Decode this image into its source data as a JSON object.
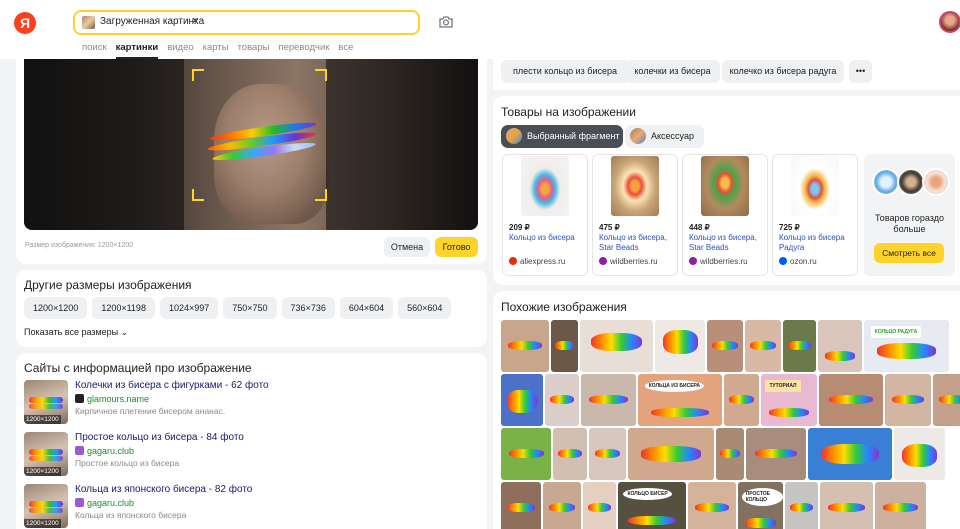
{
  "header": {
    "logo": "Я",
    "search_chip_label": "Загруженная картинка",
    "search_chip_close": "×",
    "tabs": [
      "поиск",
      "картинки",
      "видео",
      "карты",
      "товары",
      "переводчик",
      "все"
    ],
    "active_tab": "картинки"
  },
  "preview": {
    "size_note": "Размер изображения: 1200×1200",
    "cancel_label": "Отмена",
    "done_label": "Готово"
  },
  "other_sizes": {
    "title": "Другие размеры изображения",
    "sizes": [
      "1200×1200",
      "1200×1198",
      "1024×997",
      "750×750",
      "736×736",
      "604×604",
      "560×604"
    ],
    "show_all": "Показать все размеры ⌄"
  },
  "sites": {
    "title": "Сайты с информацией про изображение",
    "items": [
      {
        "title": "Колечки из бисера с фигурками - 62 фото",
        "domain": "glamours.name",
        "desc": "Кирпичное плетение бисером ананас.",
        "dim": "1200×1200",
        "favicon": "#222222"
      },
      {
        "title": "Простое кольцо из бисера - 84 фото",
        "domain": "gagaru.club",
        "desc": "Простое кольцо из бисера",
        "dim": "1200×1200",
        "favicon": "#9b59d6"
      },
      {
        "title": "Кольца из японского бисера - 82 фото",
        "domain": "gagaru.club",
        "desc": "Кольца из японского бисера",
        "dim": "1200×1200",
        "favicon": "#9b59d6"
      }
    ]
  },
  "tags": [
    "плести кольцо из бисера",
    "колечки из бисера",
    "колечко из бисера радуга",
    "•••"
  ],
  "products": {
    "title": "Товары на изображении",
    "filters": [
      "Выбранный фрагмент",
      "Аксессуар"
    ],
    "items": [
      {
        "price": "209 ₽",
        "name": "Кольцо из бисера",
        "shop": "aliexpress.ru",
        "shop_color": "#e62e04"
      },
      {
        "price": "475 ₽",
        "name": "Кольцо из бисера, Star Beads",
        "shop": "wildberries.ru",
        "shop_color": "#8b1fa9"
      },
      {
        "price": "448 ₽",
        "name": "Кольцо из бисера, Star Beads",
        "shop": "wildberries.ru",
        "shop_color": "#8b1fa9"
      },
      {
        "price": "725 ₽",
        "name": "Кольцо из бисера Радуга",
        "shop": "ozon.ru",
        "shop_color": "#005bff"
      }
    ],
    "more_text": "Товаров гораздо больше",
    "more_button": "Смотреть все"
  },
  "similar": {
    "title": "Похожие изображения",
    "labels": [
      "КОЛЬЦА ИЗ БИСЕРА",
      "ТУТОРИАЛ",
      "КОЛЬЦО РАДУГА",
      "КОЛЬЦО БИСЕР",
      "ПРОСТОЕ КОЛЬЦО"
    ]
  }
}
